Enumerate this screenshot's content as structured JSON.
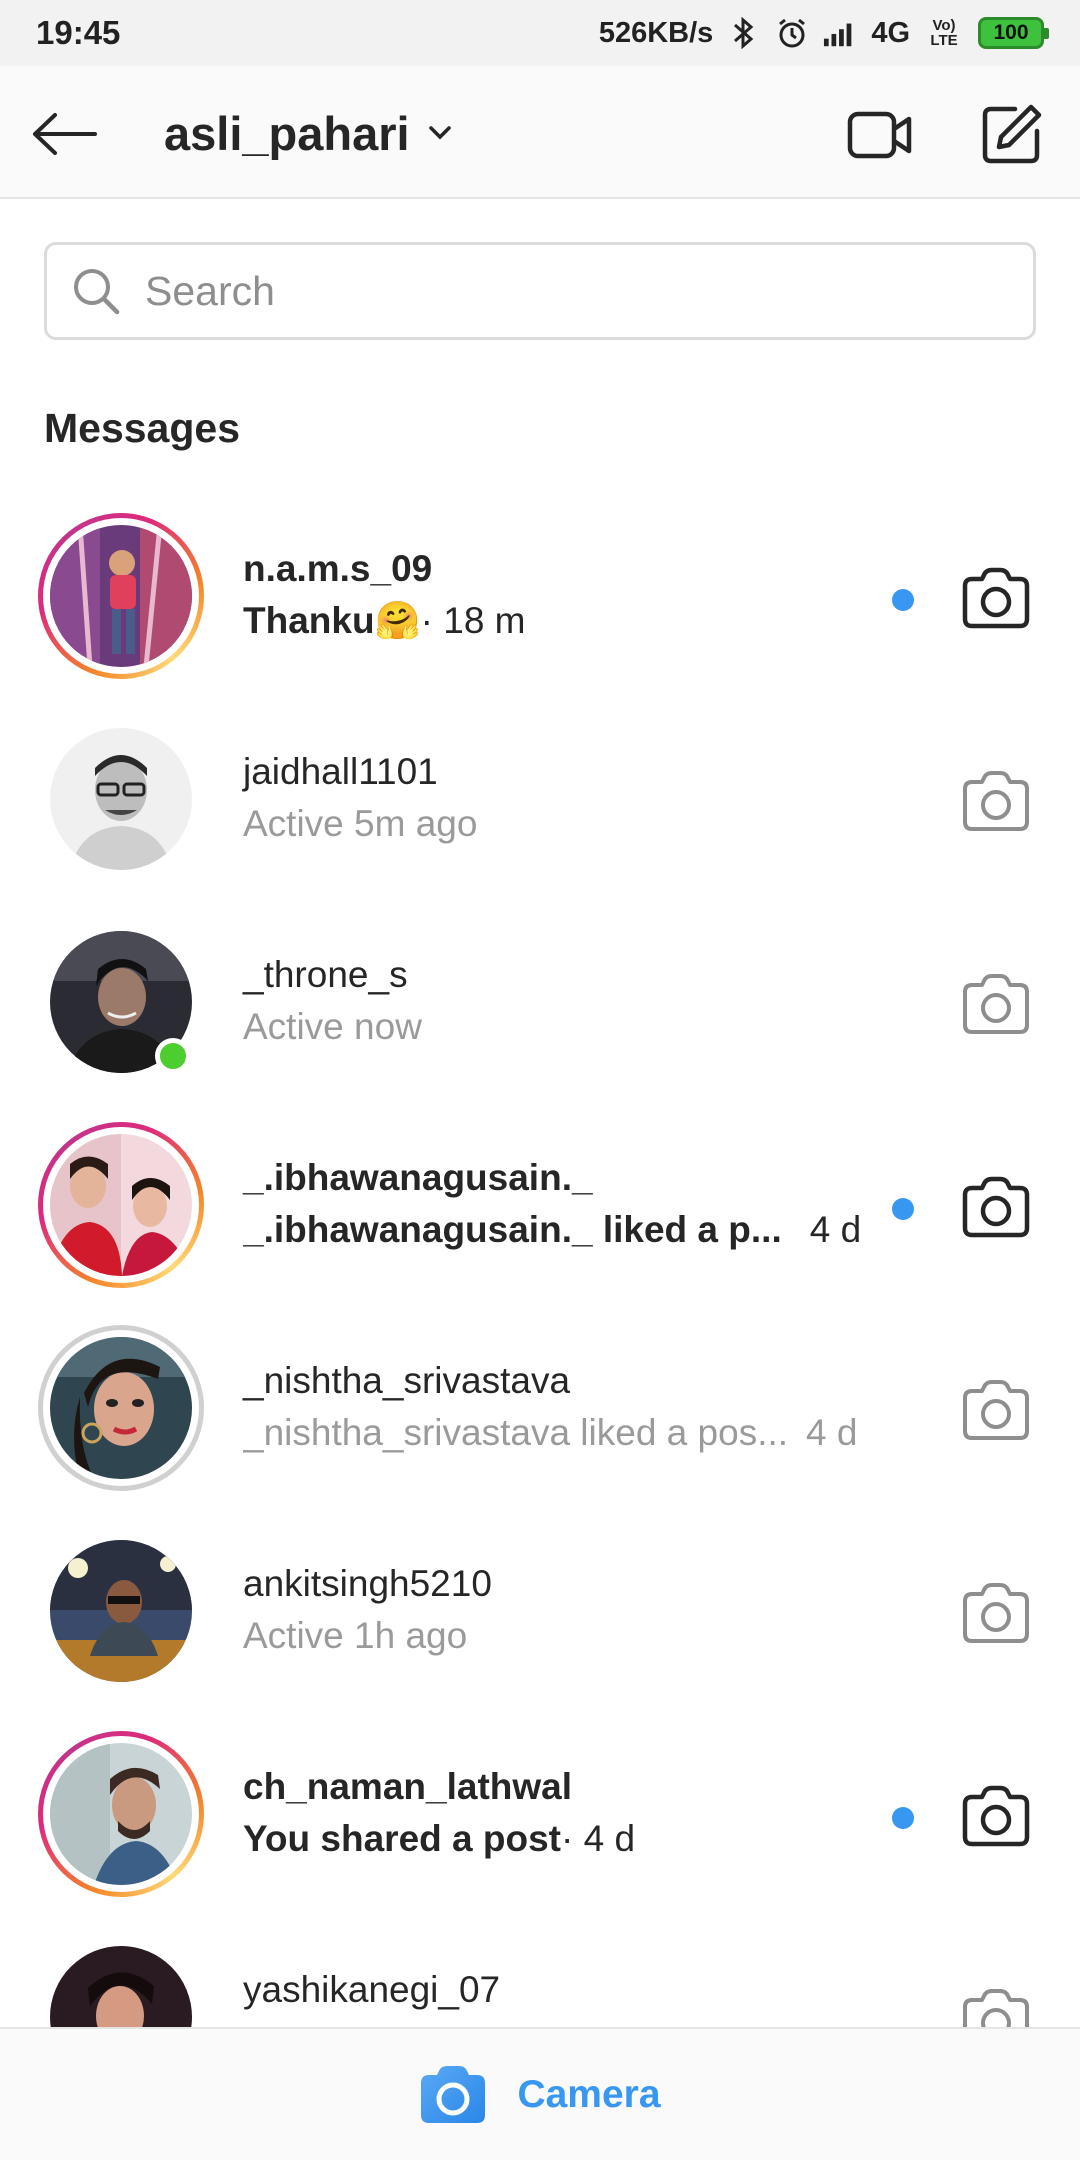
{
  "status_bar": {
    "time": "19:45",
    "speed": "526KB/s",
    "network": "4G",
    "volte": "Vo) LTE",
    "battery": "100"
  },
  "header": {
    "title": "asli_pahari"
  },
  "search": {
    "placeholder": "Search"
  },
  "section_title": "Messages",
  "conversations": [
    {
      "username": "n.a.m.s_09",
      "message": "Thanku🤗",
      "time": " · 18 m"
    },
    {
      "username": "jaidhall1101",
      "message": "Active 5m ago",
      "time": ""
    },
    {
      "username": "_throne_s",
      "message": "Active now",
      "time": ""
    },
    {
      "username": "_.ibhawanagusain._",
      "message": "_.ibhawanagusain._ liked a p...",
      "time": "4 d"
    },
    {
      "username": "_nishtha_srivastava",
      "message": "_nishtha_srivastava liked a pos...",
      "time": "4 d"
    },
    {
      "username": "ankitsingh5210",
      "message": "Active 1h ago",
      "time": ""
    },
    {
      "username": "ch_naman_lathwal",
      "message": "You shared a post",
      "time": " · 4 d"
    },
    {
      "username": "yashikanegi_07",
      "message": "",
      "time": ""
    }
  ],
  "bottom_bar": {
    "label": "Camera"
  },
  "colors": {
    "accent": "#3897f0",
    "online": "#4cce2f",
    "story_ring_start": "#f58529",
    "story_ring_end": "#dd2a7b"
  }
}
